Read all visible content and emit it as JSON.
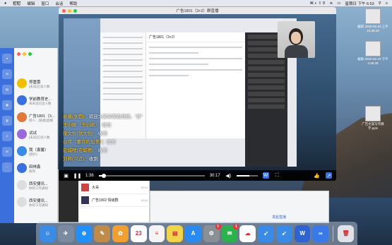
{
  "menubar": {
    "app_name": "钉钉",
    "items": [
      "编辑",
      "窗口",
      "会话",
      "帮助"
    ],
    "clock": "星期日 下午 6:53"
  },
  "player": {
    "window_title": "广告1801（3+2）群直播",
    "time_current": "1:36",
    "time_total": "30:17",
    "progress": 0.05,
    "volume": 0.6,
    "fullscreen_icon": "fullscreen-icon"
  },
  "shared_screen": {
    "chat_title": "广告1801（3+2）"
  },
  "subtitles": [
    {
      "name": "袁馨(张圆)：",
      "text": "欢迎大家来观看直播，\"好\""
    },
    {
      "name": "王小刚（王小刚）：",
      "text": "收到"
    },
    {
      "name": "张文怡(张文怡)：",
      "text": "收到"
    },
    {
      "name": "台伟（董亦的加美）：",
      "text": "收到"
    },
    {
      "name": "宏城嗯(宏城嗯)：",
      "text": "收到"
    },
    {
      "name": "刘邦(习近)：",
      "text": "收到"
    }
  ],
  "dingtalk": {
    "chats": [
      {
        "name": "郑重蕾",
        "preview": "[未读]已读人数"
      },
      {
        "name": "学前教育史...",
        "preview": "末未读已读人数"
      },
      {
        "name": "广告1801（3...",
        "preview": "杨人：[链接]直播"
      },
      {
        "name": "试试",
        "preview": "[未读]已读人数"
      },
      {
        "name": "我（袁馨）",
        "preview": "[图片]"
      },
      {
        "name": "田林鑫",
        "preview": "收到"
      },
      {
        "name": "西安捷讯...",
        "preview": "你的工作通知"
      },
      {
        "name": "西安捷讯...",
        "preview": "你的工作通知"
      }
    ]
  },
  "window2": {
    "rows": [
      {
        "name": "大哥",
        "time": "15:14"
      },
      {
        "name": "广告1902 情级群",
        "time": "15:14"
      }
    ]
  },
  "window3": {
    "link_text": "发起直播"
  },
  "desktop": {
    "top_file": "截屏 2020-02-23 上午10.38.28",
    "mid_file": "截屏 2020-02-23 下午4.38.28",
    "bottom_file": "广告文案写作教学.pptx"
  },
  "dock_apps": [
    {
      "name": "finder-icon",
      "glyph": "☺",
      "color": "#3b8ce4"
    },
    {
      "name": "launchpad-icon",
      "glyph": "✈",
      "color": "#7a8aa0"
    },
    {
      "name": "safari-icon",
      "glyph": "⊕",
      "color": "#1e90ff"
    },
    {
      "name": "notes-icon",
      "glyph": "✎",
      "color": "#c08a4a"
    },
    {
      "name": "photos-icon",
      "glyph": "✿",
      "color": "#f0a030"
    },
    {
      "name": "calendar-icon",
      "glyph": "23",
      "color": "#ffffff"
    },
    {
      "name": "reminders-icon",
      "glyph": "≡",
      "color": "#f4f4f4"
    },
    {
      "name": "stickies-icon",
      "glyph": "▤",
      "color": "#f2d44a"
    },
    {
      "name": "app-store-icon",
      "glyph": "A",
      "color": "#2a8af0"
    },
    {
      "name": "system-preferences-icon",
      "glyph": "⚙",
      "color": "#8a8f96"
    },
    {
      "name": "wechat-icon",
      "glyph": "✉",
      "color": "#2bb24c"
    },
    {
      "name": "messages-icon",
      "glyph": "☁",
      "color": "#ffffff"
    },
    {
      "name": "dingtalk-icon",
      "glyph": "➹",
      "color": "#3a8ae8"
    },
    {
      "name": "dingtalk-alt-icon",
      "glyph": "➹",
      "color": "#3a8ae8"
    },
    {
      "name": "wps-icon",
      "glyph": "W",
      "color": "#2e63d0"
    },
    {
      "name": "linked-circles-icon",
      "glyph": "∞",
      "color": "#3a7ae8"
    },
    {
      "name": "trash-icon",
      "glyph": "🗑",
      "color": "#dfe3e8"
    }
  ],
  "dock_badge": "1",
  "wechat_badge": "1"
}
